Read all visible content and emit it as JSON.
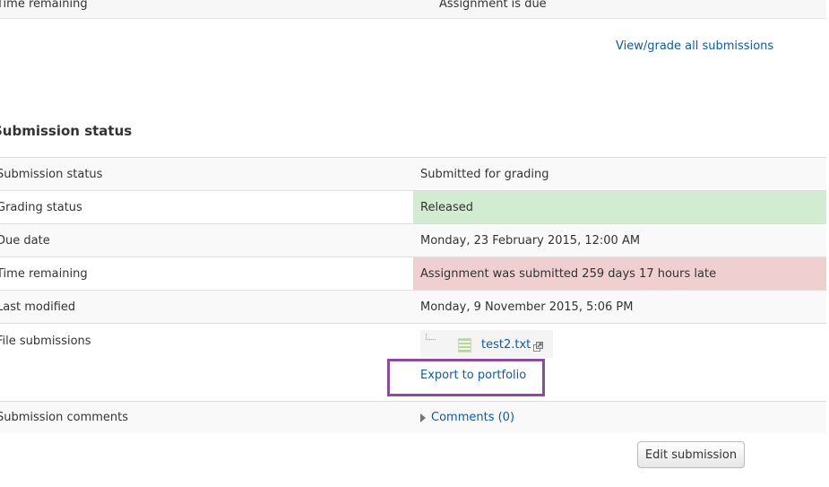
{
  "top_row": {
    "label": "Time remaining",
    "value": "Assignment is due"
  },
  "view_all_link": "View/grade all submissions",
  "section_title": "Submission status",
  "rows": [
    {
      "label": "Submission status",
      "value": "Submitted for grading"
    },
    {
      "label": "Grading status",
      "value": "Released"
    },
    {
      "label": "Due date",
      "value": "Monday, 23 February 2015, 12:00 AM"
    },
    {
      "label": "Time remaining",
      "value": "Assignment was submitted 259 days 17 hours late"
    },
    {
      "label": "Last modified",
      "value": "Monday, 9 November 2015, 5:06 PM"
    },
    {
      "label": "File submissions",
      "file_name": "test2.txt",
      "export_link": "Export to portfolio"
    },
    {
      "label": "Submission comments",
      "comments_link": "Comments (0)"
    }
  ],
  "edit_button": "Edit submission",
  "colors": {
    "link": "#0f5b9e",
    "released_bg": "#d1ecd1",
    "late_bg": "#efcfcf",
    "highlight_border": "#8d4a9e"
  },
  "icons": {
    "file": "text-file-icon",
    "export": "portfolio-export-icon",
    "expand": "expand-triangle-icon"
  }
}
